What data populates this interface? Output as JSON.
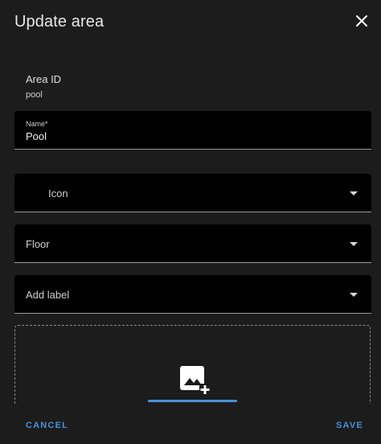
{
  "dialog": {
    "title": "Update area"
  },
  "area_id": {
    "label": "Area ID",
    "value": "pool"
  },
  "fields": {
    "name": {
      "label": "Name*",
      "value": "Pool"
    },
    "icon": {
      "placeholder": "Icon"
    },
    "floor": {
      "placeholder": "Floor"
    },
    "label": {
      "placeholder": "Add label"
    }
  },
  "actions": {
    "cancel": "CANCEL",
    "save": "SAVE"
  },
  "colors": {
    "accent": "#4a90d9",
    "background": "#1c1c1c",
    "field_bg": "#000000"
  },
  "icons": {
    "close": "close-icon",
    "upload": "image-plus-icon",
    "dropdown": "dropdown-arrow-icon"
  }
}
